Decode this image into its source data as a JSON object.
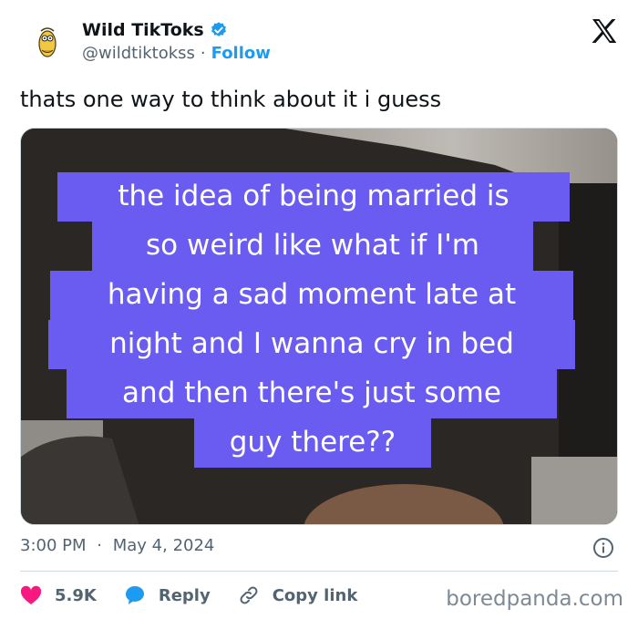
{
  "author": {
    "name": "Wild TikToks",
    "handle": "@wildtiktokss",
    "separator": "·",
    "follow_label": "Follow"
  },
  "tweet": {
    "text": "thats one way to think about it i guess",
    "caption_lines": [
      "the idea of being married is",
      "so weird like what if I'm",
      "having a sad moment late at",
      "night and I wanna cry in bed",
      "and then there's just some",
      "guy there??"
    ],
    "time": "3:00 PM",
    "date": "May 4, 2024",
    "meta_separator": "·"
  },
  "actions": {
    "likes": "5.9K",
    "reply_label": "Reply",
    "copy_label": "Copy link"
  },
  "watermark": "boredpanda.com",
  "icons": {
    "platform": "x-logo-icon",
    "verified": "verified-badge-icon",
    "info": "info-icon",
    "like": "heart-icon",
    "reply": "speech-bubble-icon",
    "copy": "link-icon"
  },
  "colors": {
    "accent": "#1d9bf0",
    "like": "#f91880",
    "caption_bg": "#6a5cf0",
    "muted": "#536471"
  }
}
